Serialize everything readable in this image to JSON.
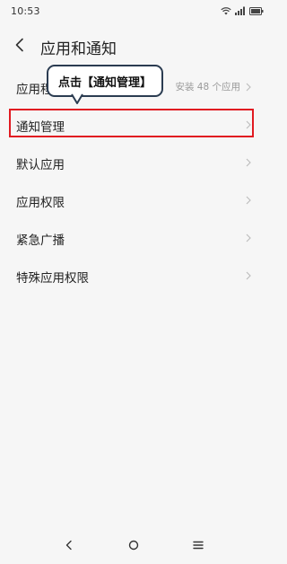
{
  "status_bar": {
    "time": "10:53",
    "icons": [
      "wifi-icon",
      "signal-icon",
      "battery-icon"
    ]
  },
  "header": {
    "title": "应用和通知",
    "back_icon": "back-arrow-icon"
  },
  "list": {
    "items": [
      {
        "label": "应用程",
        "value": "安装 48 个应用"
      },
      {
        "label": "通知管理",
        "value": ""
      },
      {
        "label": "默认应用",
        "value": ""
      },
      {
        "label": "应用权限",
        "value": ""
      },
      {
        "label": "紧急广播",
        "value": ""
      },
      {
        "label": "特殊应用权限",
        "value": ""
      }
    ]
  },
  "annotation": {
    "tooltip_text": "点击【通知管理】",
    "highlight_color": "#e11a21",
    "tooltip_border_color": "#2b3c51"
  },
  "nav_bar": {
    "icons": [
      "nav-back-icon",
      "nav-home-icon",
      "nav-menu-icon"
    ]
  }
}
